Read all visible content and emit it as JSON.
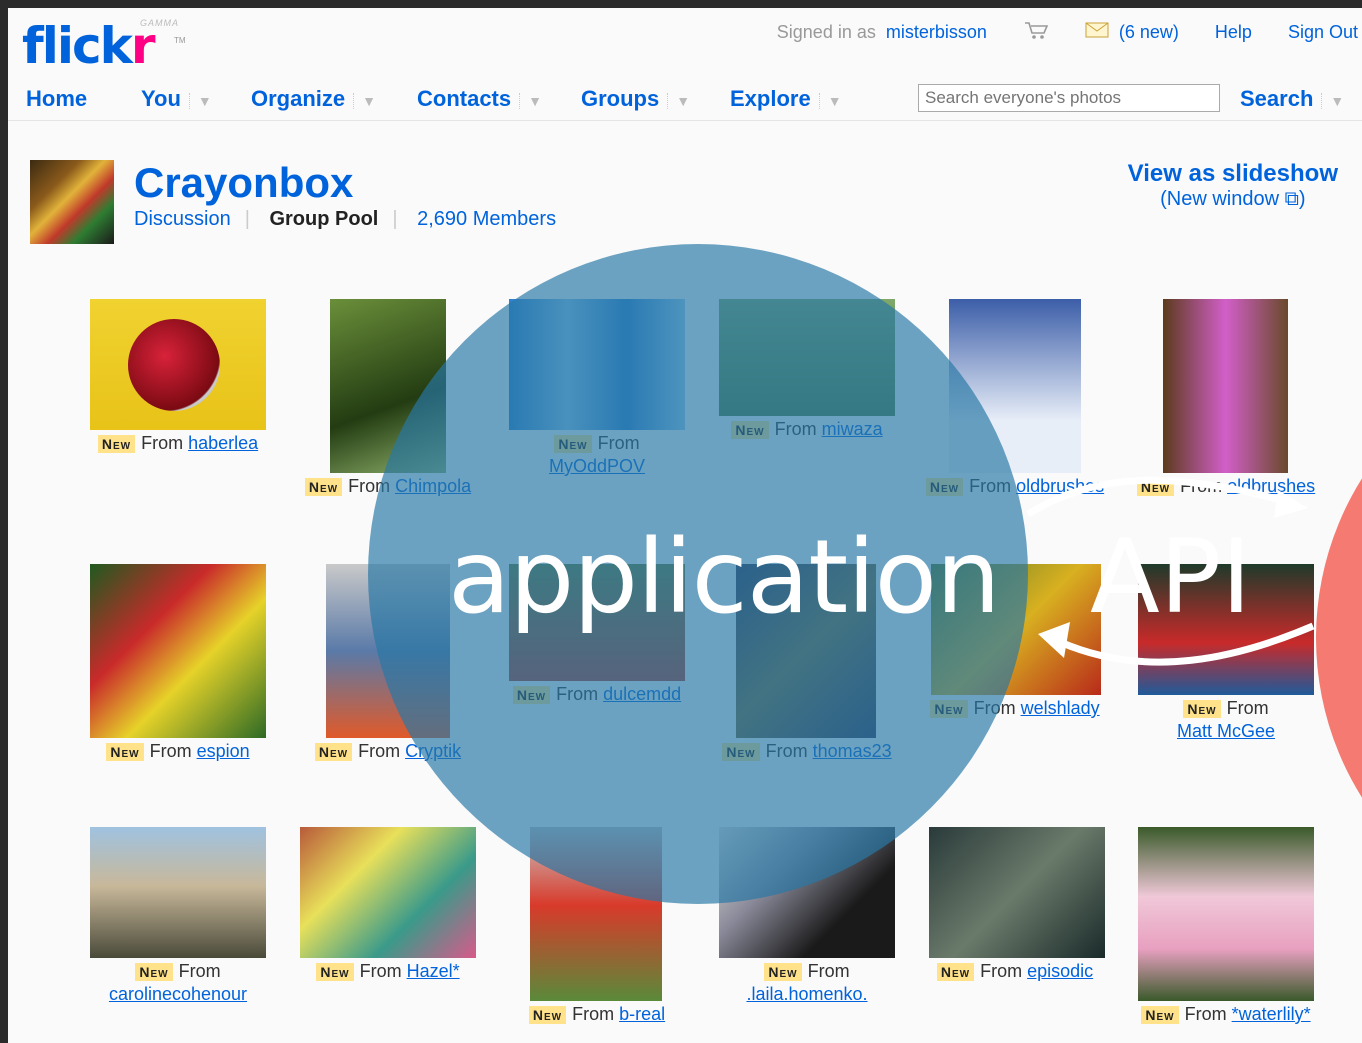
{
  "header": {
    "logo_part1": "flick",
    "logo_part2": "r",
    "logo_badge": "GAMMA",
    "logo_tm": "TM",
    "signed_in_prefix": "Signed in as",
    "username": "misterbisson",
    "mail_count": "(6 new)",
    "help": "Help",
    "sign_out": "Sign Out"
  },
  "nav": {
    "items": [
      "Home",
      "You",
      "Organize",
      "Contacts",
      "Groups",
      "Explore"
    ],
    "search_placeholder": "Search everyone's photos",
    "search_button": "Search"
  },
  "group": {
    "title": "Crayonbox",
    "tabs": [
      "Discussion",
      "Group Pool",
      "2,690 Members"
    ],
    "active_tab": "Group Pool",
    "slideshow_title": "View as slideshow",
    "slideshow_sub": "(New window ⧉)"
  },
  "new_badge": "New",
  "from_word": "From",
  "photos": [
    {
      "user": "haberlea"
    },
    {
      "user": "Chimpola"
    },
    {
      "user": "MyOddPOV"
    },
    {
      "user": "miwaza"
    },
    {
      "user": "oldbrushes"
    },
    {
      "user": "oldbrushes"
    },
    {
      "user": "espion"
    },
    {
      "user": "Cryptik"
    },
    {
      "user": "dulcemdd"
    },
    {
      "user": "thomas23"
    },
    {
      "user": "welshlady"
    },
    {
      "user": "Matt McGee"
    },
    {
      "user": "carolinecohenour"
    },
    {
      "user": "Hazel*"
    },
    {
      "user": "b-real"
    },
    {
      "user": ".laila.homenko."
    },
    {
      "user": "episodic"
    },
    {
      "user": "*waterlily*"
    }
  ],
  "overlay": {
    "application": "application",
    "api": "API"
  },
  "colors": {
    "flickr_blue": "#0063dc",
    "flickr_pink": "#ff0084",
    "bubble": "#2878a5",
    "red_circle": "#f47a72"
  }
}
